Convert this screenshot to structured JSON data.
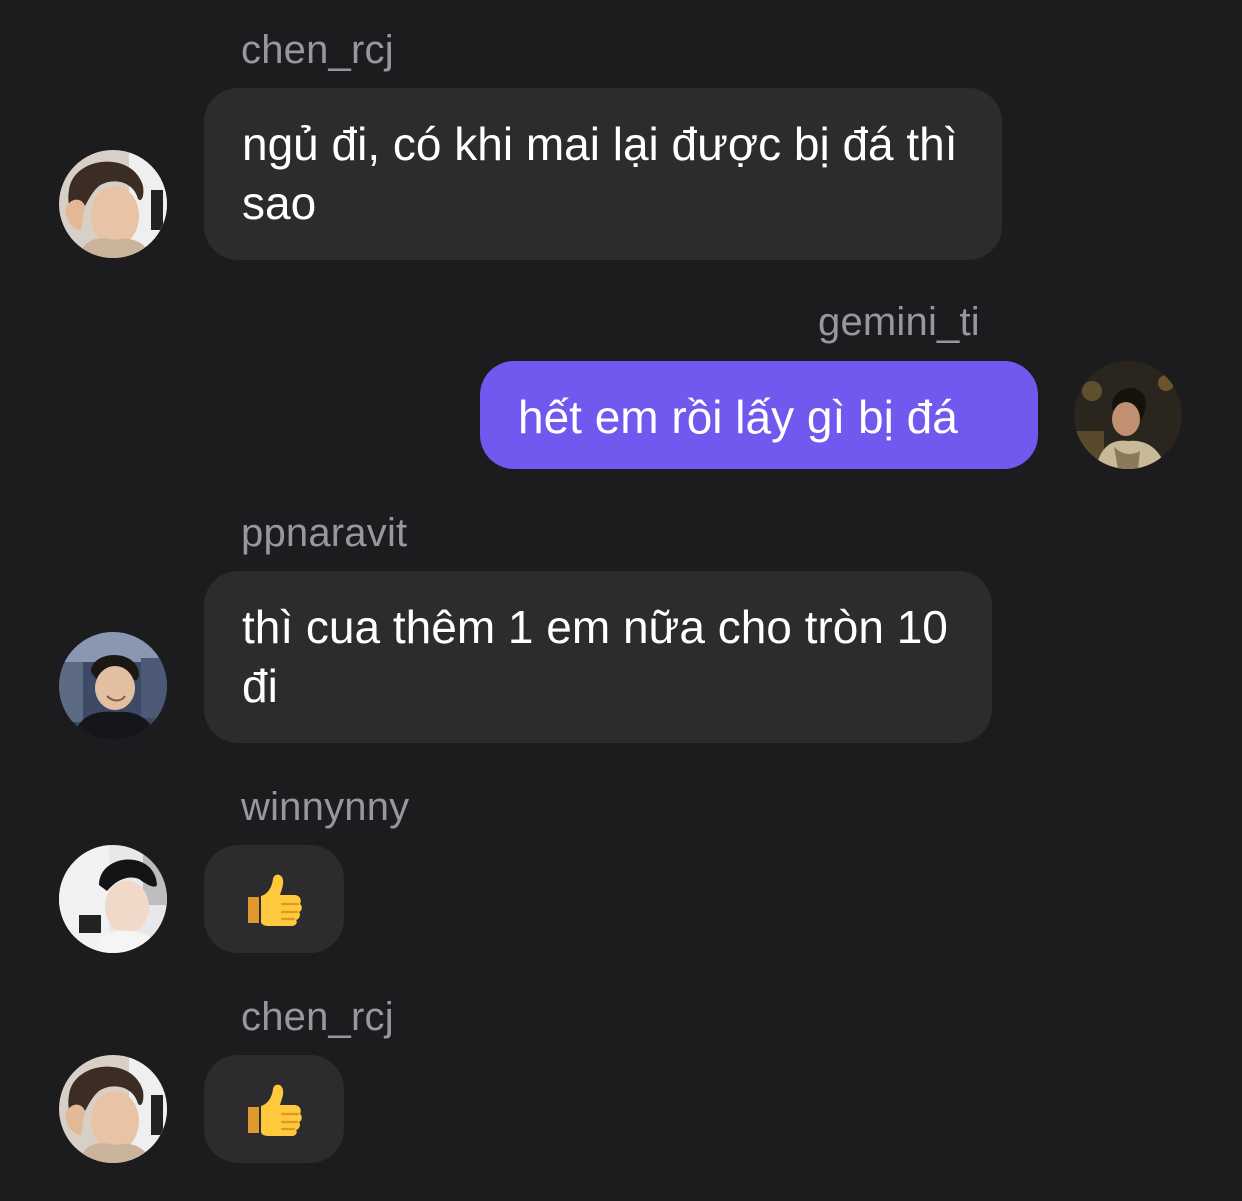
{
  "messages": [
    {
      "username": "chen_rcj",
      "text": "ngủ đi, có khi mai lại được bị đá thì sao",
      "avatar_icon": "avatar-photo-icon"
    },
    {
      "username": "gemini_ti",
      "text": "hết em rồi lấy gì bị đá",
      "avatar_icon": "avatar-photo-icon"
    },
    {
      "username": "ppnaravit",
      "text": "thì cua thêm 1 em nữa cho tròn 10 đi",
      "avatar_icon": "avatar-photo-icon"
    },
    {
      "username": "winnynny",
      "emoji": "thumbs-up-icon",
      "avatar_icon": "avatar-photo-icon"
    },
    {
      "username": "chen_rcj",
      "emoji": "thumbs-up-icon",
      "avatar_icon": "avatar-photo-icon"
    }
  ],
  "colors": {
    "background": "#1c1c1e",
    "incoming_bubble": "#2c2c2e",
    "outgoing_bubble": "#7059ef",
    "username_text": "#97979c",
    "message_text": "#ffffff"
  }
}
